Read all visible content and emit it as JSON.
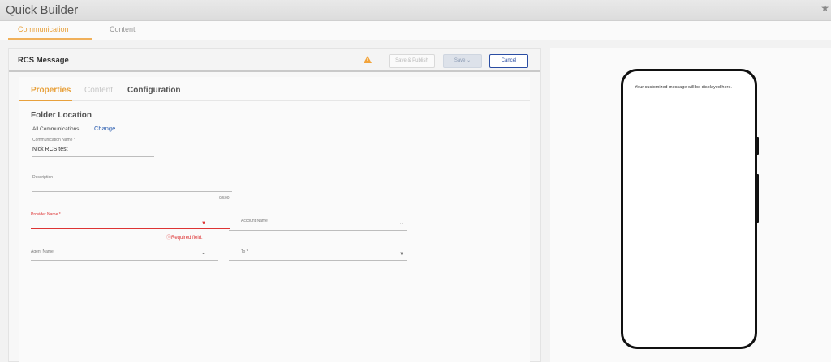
{
  "app": {
    "title": "Quick Builder"
  },
  "top_tabs": [
    {
      "label": "Communication",
      "active": true
    },
    {
      "label": "Content",
      "active": false
    }
  ],
  "header": {
    "title": "RCS Message",
    "warning_icon": "warning-triangle-icon",
    "save_publish_label": "Save & Publish",
    "save_label": "Save ⌄",
    "cancel_label": "Cancel"
  },
  "inner_tabs": [
    {
      "label": "Properties",
      "active": true
    },
    {
      "label": "Content",
      "active": false
    },
    {
      "label": "Configuration",
      "active": false
    }
  ],
  "folder": {
    "heading": "Folder Location",
    "value": "All Communications",
    "change_label": "Change"
  },
  "fields": {
    "communication_name": {
      "label": "Communication Name *",
      "value": "Nick RCS test"
    },
    "description": {
      "label": "Description",
      "counter": "0/500"
    },
    "provider_name": {
      "label": "Provider Name *",
      "error": "Required field."
    },
    "account_name": {
      "label": "Account Name"
    },
    "agent_name": {
      "label": "Agent Name"
    },
    "to": {
      "label": "To *"
    }
  },
  "preview": {
    "message": "Your customized message will be displayed here."
  },
  "colors": {
    "accent": "#e8a13c",
    "primary": "#2a4da3",
    "error": "#d33333"
  }
}
